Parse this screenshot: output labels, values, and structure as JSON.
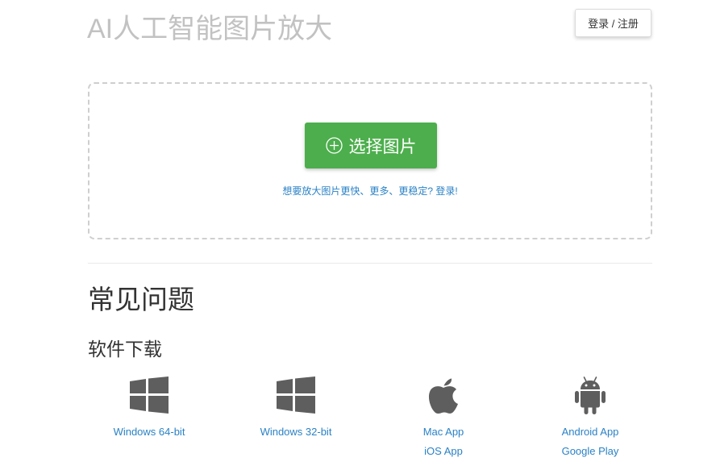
{
  "header": {
    "title": "AI人工智能图片放大",
    "login_label": "登录 / 注册"
  },
  "upload": {
    "button_label": "选择图片",
    "hint": "想要放大图片更快、更多、更稳定? 登录!"
  },
  "faq": {
    "title": "常见问题"
  },
  "downloads": {
    "title": "软件下载",
    "items": [
      {
        "icon": "windows-icon",
        "links": [
          "Windows 64-bit"
        ]
      },
      {
        "icon": "windows-icon",
        "links": [
          "Windows 32-bit"
        ]
      },
      {
        "icon": "apple-icon",
        "links": [
          "Mac App",
          "iOS App"
        ]
      },
      {
        "icon": "android-icon",
        "links": [
          "Android App",
          "Google Play"
        ]
      }
    ]
  },
  "colors": {
    "accent_green": "#4cae4c",
    "link_blue": "#2a82c6",
    "title_gray": "#c2c2c2",
    "icon_gray": "#5e5e5e"
  }
}
